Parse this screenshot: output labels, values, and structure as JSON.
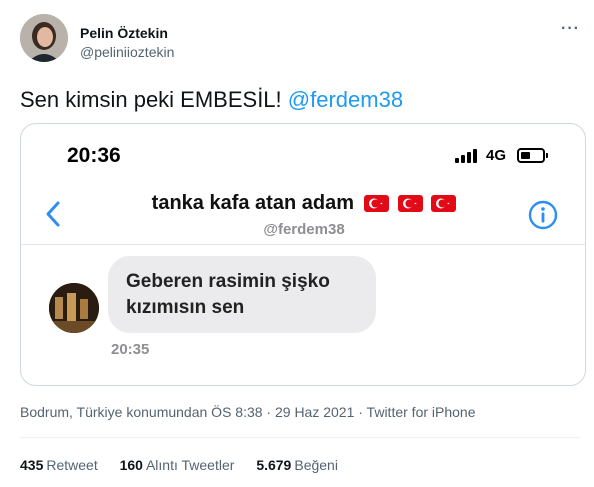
{
  "author": {
    "display_name": "Pelin Öztekin",
    "handle": "@peliniioztekin"
  },
  "more_label": "···",
  "tweet": {
    "text": "Sen kimsin peki EMBESİL! ",
    "mention": "@ferdem38"
  },
  "screenshot": {
    "status_time": "20:36",
    "network": "4G",
    "chat_name": "tanka kafa atan adam",
    "chat_handle": "@ferdem38",
    "message_line1": "Geberen rasimin şişko",
    "message_line2": "kızımısın sen",
    "message_time": "20:35"
  },
  "meta": {
    "location_time": "Bodrum, Türkiye konumundan ÖS 8:38 · 29 Haz 2021 · Twitter for iPhone"
  },
  "stats": {
    "retweet_count": "435",
    "retweet_label": "Retweet",
    "quote_count": "160",
    "quote_label": "Alıntı Tweetler",
    "like_count": "5.679",
    "like_label": "Beğeni"
  },
  "colors": {
    "accent": "#1d9bf0",
    "ios_blue": "#2b8ef0",
    "flag_red": "#e30a17"
  },
  "icons": [
    "avatar",
    "more-icon",
    "signal-icon",
    "battery-icon",
    "back-chevron-icon",
    "info-icon",
    "turkish-flag-icon"
  ]
}
